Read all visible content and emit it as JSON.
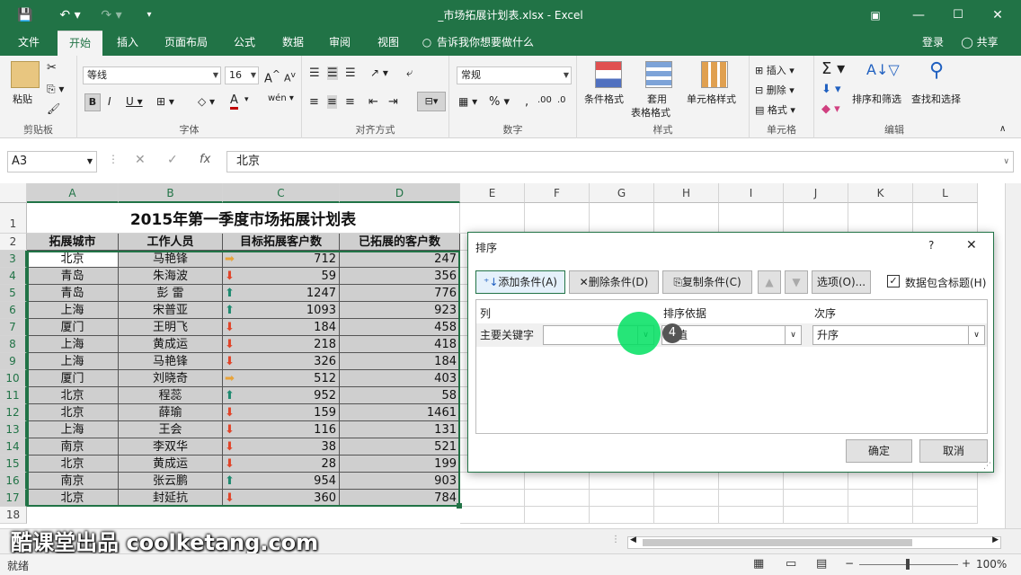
{
  "window": {
    "title": "_市场拓展计划表.xlsx - Excel"
  },
  "menu": {
    "tabs": [
      "文件",
      "开始",
      "插入",
      "页面布局",
      "公式",
      "数据",
      "审阅",
      "视图"
    ],
    "tell_me": "告诉我你想要做什么",
    "login": "登录",
    "share": "共享"
  },
  "ribbon": {
    "clipboard": {
      "label": "剪贴板",
      "paste": "粘贴"
    },
    "font": {
      "label": "字体",
      "name": "等线",
      "size": "16"
    },
    "align": {
      "label": "对齐方式"
    },
    "number": {
      "label": "数字",
      "format": "常规"
    },
    "styles": {
      "label": "样式",
      "cond": "条件格式",
      "table1": "套用",
      "table2": "表格格式",
      "cell": "单元格样式"
    },
    "cells": {
      "label": "单元格",
      "insert": "插入",
      "delete": "删除",
      "format": "格式"
    },
    "edit": {
      "label": "编辑",
      "sort": "排序和筛选",
      "find": "查找和选择"
    }
  },
  "formula": {
    "namebox": "A3",
    "fx": "fx",
    "value": "北京"
  },
  "grid": {
    "columns": [
      "A",
      "B",
      "C",
      "D",
      "E",
      "F",
      "G",
      "H",
      "I",
      "J",
      "K",
      "L"
    ],
    "title": "2015年第一季度市场拓展计划表",
    "headers": [
      "拓展城市",
      "工作人员",
      "目标拓展客户数",
      "已拓展的客户数"
    ],
    "rows": [
      {
        "n": "3",
        "city": "北京",
        "name": "马艳锋",
        "target": "712",
        "done": "247",
        "arrow": "right"
      },
      {
        "n": "4",
        "city": "青岛",
        "name": "朱海波",
        "target": "59",
        "done": "356",
        "arrow": "down"
      },
      {
        "n": "5",
        "city": "青岛",
        "name": "彭  雷",
        "target": "1247",
        "done": "776",
        "arrow": "up"
      },
      {
        "n": "6",
        "city": "上海",
        "name": "宋普亚",
        "target": "1093",
        "done": "923",
        "arrow": "up"
      },
      {
        "n": "7",
        "city": "厦门",
        "name": "王明飞",
        "target": "184",
        "done": "458",
        "arrow": "down"
      },
      {
        "n": "8",
        "city": "上海",
        "name": "黄成运",
        "target": "218",
        "done": "418",
        "arrow": "down"
      },
      {
        "n": "9",
        "city": "上海",
        "name": "马艳锋",
        "target": "326",
        "done": "184",
        "arrow": "down"
      },
      {
        "n": "10",
        "city": "厦门",
        "name": "刘晓奇",
        "target": "512",
        "done": "403",
        "arrow": "right"
      },
      {
        "n": "11",
        "city": "北京",
        "name": "程蕊",
        "target": "952",
        "done": "58",
        "arrow": "up"
      },
      {
        "n": "12",
        "city": "北京",
        "name": "薛瑜",
        "target": "159",
        "done": "1461",
        "arrow": "down"
      },
      {
        "n": "13",
        "city": "上海",
        "name": "王会",
        "target": "116",
        "done": "131",
        "arrow": "down"
      },
      {
        "n": "14",
        "city": "南京",
        "name": "李双华",
        "target": "38",
        "done": "521",
        "arrow": "down"
      },
      {
        "n": "15",
        "city": "北京",
        "name": "黄成运",
        "target": "28",
        "done": "199",
        "arrow": "down"
      },
      {
        "n": "16",
        "city": "南京",
        "name": "张云鹏",
        "target": "954",
        "done": "903",
        "arrow": "up"
      },
      {
        "n": "17",
        "city": "北京",
        "name": "封延抗",
        "target": "360",
        "done": "784",
        "arrow": "down"
      }
    ],
    "extra_rows": [
      "1",
      "2",
      "18"
    ]
  },
  "dialog": {
    "title": "排序",
    "help": "?",
    "close": "✕",
    "add": "添加条件(A)",
    "delete": "删除条件(D)",
    "copy": "复制条件(C)",
    "options": "选项(O)...",
    "header_check": "数据包含标题(H)",
    "col_head": "列",
    "basis_head": "排序依据",
    "order_head": "次序",
    "key_label": "主要关键字",
    "basis_value": "数值",
    "order_value": "升序",
    "ok": "确定",
    "cancel": "取消",
    "marker": "4"
  },
  "status": {
    "ready": "就绪",
    "zoom": "100%"
  },
  "watermark": "酷课堂出品 coolketang.com",
  "colors": {
    "brand": "#217346",
    "arrow_up": "#1f8a70",
    "arrow_down": "#e0452a",
    "arrow_right": "#e8a33a",
    "cursor": "#00e060"
  }
}
